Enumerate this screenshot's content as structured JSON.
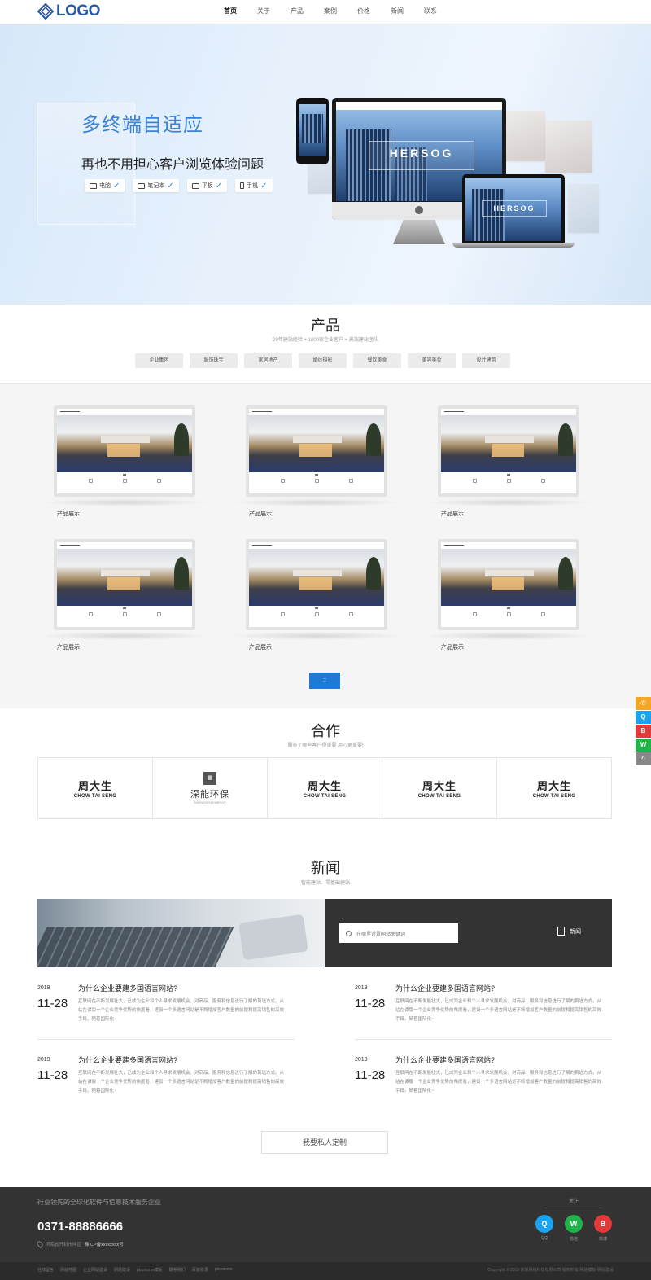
{
  "header": {
    "logo_text": "LOGO",
    "nav": [
      "首页",
      "关于",
      "产品",
      "案例",
      "价格",
      "新闻",
      "联系"
    ],
    "active_index": 0
  },
  "banner": {
    "title": "多终端自适应",
    "subtitle": "再也不用担心客户浏览体验问题",
    "devices": [
      {
        "label": "电脑",
        "icon": "monitor-icon"
      },
      {
        "label": "笔记本",
        "icon": "laptop-icon"
      },
      {
        "label": "平板",
        "icon": "tablet-icon"
      },
      {
        "label": "手机",
        "icon": "phone-icon"
      }
    ],
    "mockup_brand": "HERSOG"
  },
  "products": {
    "title": "产品",
    "subtitle": "20年建站经验 + 1000家企业客户 + 高端建站团队",
    "tabs": [
      "企业集团",
      "服饰珠宝",
      "家居地产",
      "婚纱摄影",
      "餐饮美食",
      "美容美妆",
      "设计建筑"
    ],
    "items": [
      {
        "label": "产品展示"
      },
      {
        "label": "产品展示"
      },
      {
        "label": "产品展示"
      },
      {
        "label": "产品展示"
      },
      {
        "label": "产品展示"
      },
      {
        "label": "产品展示"
      }
    ],
    "more_label": "::"
  },
  "partners": {
    "title": "合作",
    "subtitle": "服务了哪些客户得重要 用心更重要!",
    "items": [
      {
        "cn": "周大生",
        "en": "CHOW TAI SENG",
        "type": "cts"
      },
      {
        "cn": "深能环保",
        "en": "SHENZHEN ENERGY",
        "type": "sn"
      },
      {
        "cn": "周大生",
        "en": "CHOW TAI SENG",
        "type": "cts"
      },
      {
        "cn": "周大生",
        "en": "CHOW TAI SENG",
        "type": "cts"
      },
      {
        "cn": "周大生",
        "en": "CHOW TAI SENG",
        "type": "cts"
      }
    ]
  },
  "news": {
    "title": "新闻",
    "subtitle": "智能建站、零基础建站",
    "search_placeholder": "在哪里设置网站关键词",
    "news_button": "新闻",
    "items": [
      {
        "year": "2019",
        "date": "11-28",
        "title": "为什么企业要建多国语言网站?",
        "desc": "互联网在不断发展壮大，已成为企业和个人寻求发展机会、对商品、服务和信息进行了解的首选方式。从站在谭版一个企业竞争优势的角度看，建设一个多语言网站是不断增加客户数量的前提和提高销售的高效手段。随着国际化~"
      },
      {
        "year": "2019",
        "date": "11-28",
        "title": "为什么企业要建多国语言网站?",
        "desc": "互联网在不断发展壮大，已成为企业和个人寻求发展机会、对商品、服务和信息进行了解的首选方式。从站在谭版一个企业竞争优势的角度看，建设一个多语言网站是不断增加客户数量的前提和提高销售的高效手段。随着国际化~"
      },
      {
        "year": "2019",
        "date": "11-28",
        "title": "为什么企业要建多国语言网站?",
        "desc": "互联网在不断发展壮大，已成为企业和个人寻求发展机会、对商品、服务和信息进行了解的首选方式。从站在谭版一个企业竞争优势的角度看，建设一个多语言网站是不断增加客户数量的前提和提高销售的高效手段。随着国际化~"
      },
      {
        "year": "2019",
        "date": "11-28",
        "title": "为什么企业要建多国语言网站?",
        "desc": "互联网在不断发展壮大，已成为企业和个人寻求发展机会、对商品、服务和信息进行了解的首选方式。从站在谭版一个企业竞争优势的角度看，建设一个多语言网站是不断增加客户数量的前提和提高销售的高效手段。随着国际化~"
      }
    ],
    "custom_button": "我要私人定制"
  },
  "footer": {
    "tagline": "行业领先的全球化软件与信息技术服务企业",
    "phone": "0371-88886666",
    "address": "河南省开封市仲区",
    "icp": "豫ICP备xxxxxxxx号",
    "follow_label": "关注",
    "social": [
      {
        "label": "QQ",
        "color": "#1aa3f0",
        "glyph": "Q"
      },
      {
        "label": "微信",
        "color": "#21b24b",
        "glyph": "W"
      },
      {
        "label": "微博",
        "color": "#e23a3a",
        "glyph": "B"
      }
    ],
    "links": [
      "在线留言",
      "网站地图",
      "企业网站建设",
      "网站建设",
      "pbootcms模板",
      "联系我们",
      "百度收录",
      "pbootcms"
    ],
    "copyright": "Copyright © 2019 某某网络科技有限公司 版权所有 网站模板·网站建设"
  },
  "sidebar": [
    {
      "name": "phone",
      "color": "#f5a623",
      "glyph": "✆"
    },
    {
      "name": "qq",
      "color": "#1aa3f0",
      "glyph": "Q"
    },
    {
      "name": "weibo",
      "color": "#e23a3a",
      "glyph": "B"
    },
    {
      "name": "wechat",
      "color": "#21b24b",
      "glyph": "W"
    },
    {
      "name": "top",
      "color": "#888888",
      "glyph": "^"
    }
  ]
}
